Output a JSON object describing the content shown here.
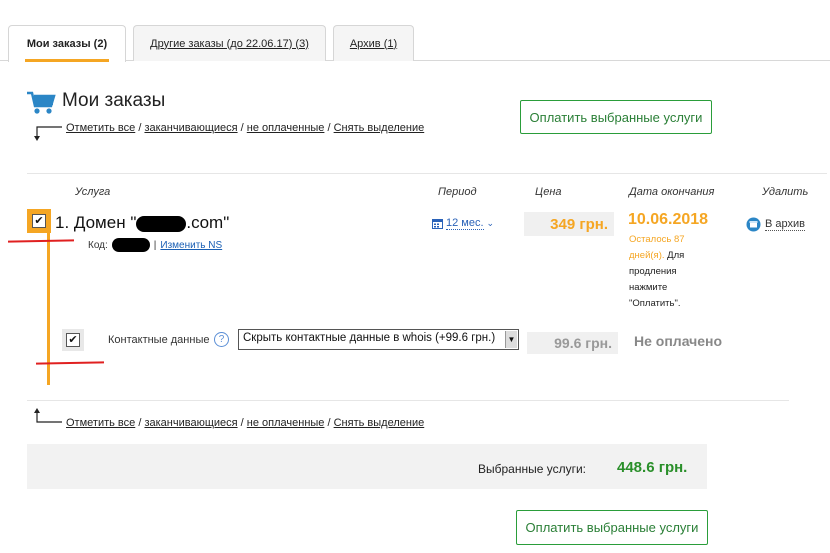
{
  "tabs": [
    {
      "label": "Мои заказы (2)",
      "active": true
    },
    {
      "label": "Другие заказы (до 22.06.17) (3)",
      "active": false
    },
    {
      "label": "Архив (1)",
      "active": false
    }
  ],
  "page_title": "Мои заказы",
  "selection_links": {
    "all": "Отметить все",
    "expiring": "заканчивающиеся",
    "unpaid": "не оплаченные",
    "clear": "Снять выделение",
    "separator": "/"
  },
  "pay_button_label": "Оплатить выбранные услуги",
  "columns": {
    "service": "Услуга",
    "period": "Период",
    "price": "Цена",
    "end_date": "Дата окончания",
    "delete": "Удалить"
  },
  "order": {
    "title_prefix": "1. Домен \"",
    "title_suffix": ".com\"",
    "code_label": "Код:",
    "code_sep": "|",
    "change_ns": "Изменить NS",
    "period": "12 мес.",
    "price": "349 грн.",
    "end_date": "10.06.2018",
    "days_left": "Осталось 87 дней(я).",
    "renew_hint": "Для продления нажмите \"Оплатить\".",
    "archive_label": "В архив",
    "checked": true
  },
  "contact": {
    "label": "Контактные данные",
    "help": "?",
    "selected_option": "Скрыть контактные данные в whois (+99.6 грн.)",
    "price": "99.6 грн.",
    "status": "Не оплачено",
    "checked": true
  },
  "summary": {
    "label": "Выбранные услуги:",
    "value": "448.6 грн."
  },
  "icons": {
    "cart": "cart-icon",
    "calendar": "calendar-icon",
    "archive": "archive-icon",
    "help": "help-icon"
  },
  "colors": {
    "accent_orange": "#f5a623",
    "green": "#2a8f2a",
    "link_blue": "#2a62b8",
    "marker_red": "#e02020"
  }
}
